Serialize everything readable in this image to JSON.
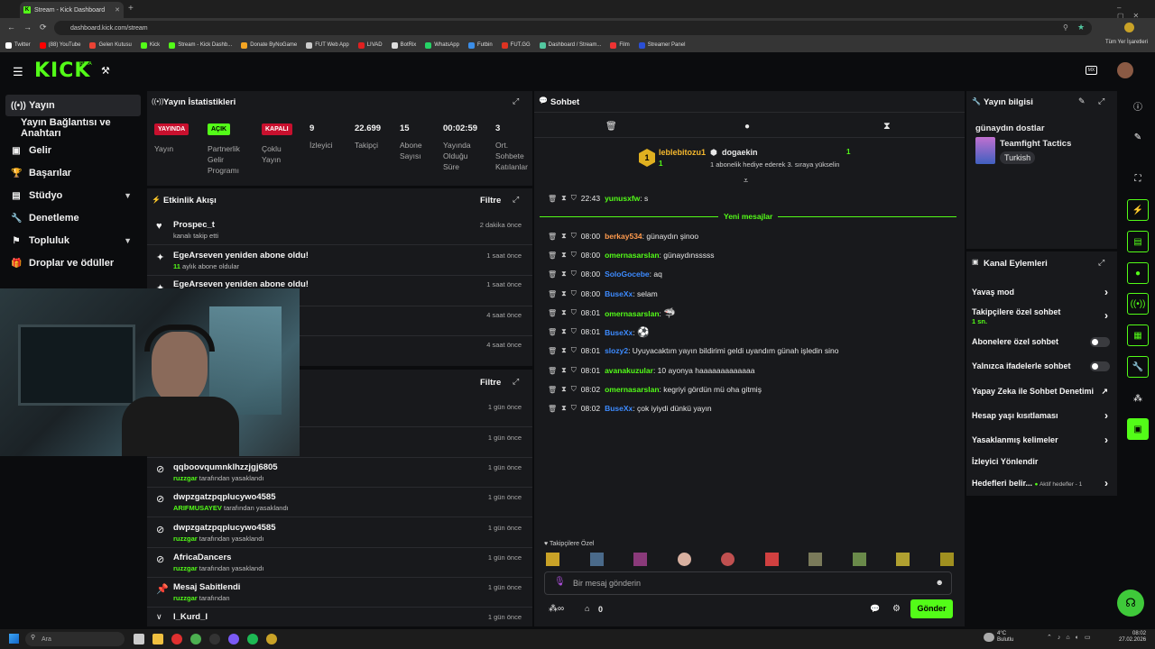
{
  "browser": {
    "tab_title": "Stream - Kick Dashboard",
    "new_tab": "+",
    "url": "dashboard.kick.com/stream",
    "bookmarks": [
      "Twitter",
      "(88) YouTube",
      "Gelen Kutusu",
      "Kick",
      "Stream - Kick Dashb...",
      "Donate ByNoGame",
      "FUT Web App",
      "LIVAD",
      "BotRix",
      "WhatsApp",
      "Futbin",
      "FUT.GG",
      "Dashboard / Stream...",
      "Film",
      "Streamer Panel"
    ],
    "all_bookmarks": "Tüm Yer İşaretleri"
  },
  "header": {
    "logo": "KICK",
    "beta": "BETA"
  },
  "sidebar": {
    "items": [
      {
        "label": "Yayın",
        "icon": "broadcast-icon"
      },
      {
        "label": "Yayın Bağlantısı ve Anahtarı"
      },
      {
        "label": "Gelir",
        "icon": "money-icon"
      },
      {
        "label": "Başarılar",
        "icon": "trophy-icon"
      },
      {
        "label": "Stüdyo",
        "icon": "studio-icon"
      },
      {
        "label": "Denetleme",
        "icon": "wrench-icon"
      },
      {
        "label": "Topluluk",
        "icon": "community-icon"
      },
      {
        "label": "Droplar ve ödüller",
        "icon": "gift-icon"
      }
    ]
  },
  "stats": {
    "title": "Yayın İstatistikleri",
    "items": [
      {
        "badge": "YAYINDA",
        "label": "Yayın"
      },
      {
        "badge": "AÇIK",
        "label": "Partnerlik Gelir Programı"
      },
      {
        "badge": "KAPALI",
        "label": "Çoklu Yayın"
      },
      {
        "value": "9",
        "label": "İzleyici"
      },
      {
        "value": "22.699",
        "label": "Takipçi"
      },
      {
        "value": "15",
        "label": "Abone Sayısı"
      },
      {
        "value": "00:02:59",
        "label": "Yayında Olduğu Süre"
      },
      {
        "value": "3",
        "label": "Ort. Sohbete Katılanlar"
      }
    ]
  },
  "activity": {
    "title": "Etkinlik Akışı",
    "filter": "Filtre",
    "rows": [
      {
        "title": "Prospec_t",
        "sub": "kanalı takip etti",
        "time": "2 dakika önce",
        "icon": "heart-icon"
      },
      {
        "title": "EgeArseven yeniden abone oldu!",
        "sub_green": "11",
        "sub": "aylık abone oldular",
        "time": "1 saat önce",
        "icon": "star-icon"
      },
      {
        "title": "EgeArseven yeniden abone oldu!",
        "sub": "",
        "time": "1 saat önce",
        "icon": "star-icon"
      },
      {
        "time": "4 saat önce"
      },
      {
        "time": "4 saat önce"
      }
    ]
  },
  "modlog": {
    "filter": "Filtre",
    "rows": [
      {
        "time": "1 gün önce"
      },
      {
        "time": "1 gün önce"
      },
      {
        "title": "qqboovqumnklhzzjgj6805",
        "mod": "ruzzgar",
        "sub": "tarafından yasaklandı",
        "time": "1 gün önce",
        "icon": "ban-icon"
      },
      {
        "title": "dwpzgatzpqplucywo4585",
        "mod": "ARIFMUSAYEV",
        "sub": "tarafından yasaklandı",
        "time": "1 gün önce",
        "icon": "ban-icon"
      },
      {
        "title": "dwpzgatzpqplucywo4585",
        "mod": "ruzzgar",
        "sub": "tarafından yasaklandı",
        "time": "1 gün önce",
        "icon": "ban-icon"
      },
      {
        "title": "AfricaDancers",
        "mod": "ruzzgar",
        "sub": "tarafından yasaklandı",
        "time": "1 gün önce",
        "icon": "ban-icon"
      },
      {
        "title": "Mesaj Sabitlendi",
        "mod": "ruzzgar",
        "sub": "tarafından",
        "time": "1 gün önce",
        "icon": "pin-icon"
      },
      {
        "title": "I_Kurd_I",
        "time": "1 gün önce",
        "icon": "chevron-down-icon"
      }
    ]
  },
  "chat": {
    "title": "Sohbet",
    "gifter1": {
      "name": "leblebitozu1",
      "count": "1"
    },
    "gifter2": {
      "name": "dogaekin",
      "count": "1",
      "note": "1 abonelik hediye ederek 3. sıraya yükselin"
    },
    "pinned": {
      "time": "22:43",
      "user": "yunusxfw",
      "text": "s"
    },
    "new_messages": "Yeni mesajlar",
    "messages": [
      {
        "time": "08:00",
        "user": "berkay534",
        "color": "orange",
        "text": "günaydın şinoo"
      },
      {
        "time": "08:00",
        "user": "omernasarslan",
        "color": "green",
        "text": "günaydınsssss"
      },
      {
        "time": "08:00",
        "user": "SoloGocebe",
        "color": "blue",
        "text": "aq"
      },
      {
        "time": "08:00",
        "user": "BuseXx",
        "color": "blue",
        "text": "selam"
      },
      {
        "time": "08:01",
        "user": "omernasarslan",
        "color": "green",
        "text": "",
        "emote": "🦈"
      },
      {
        "time": "08:01",
        "user": "BuseXx",
        "color": "blue",
        "text": "",
        "emote": "⚽"
      },
      {
        "time": "08:01",
        "user": "slozy2",
        "color": "blue",
        "text": "Uyuyacaktım yayın bildirimi geldi uyandım günah işledin sino"
      },
      {
        "time": "08:01",
        "user": "avanakuzular",
        "color": "green",
        "text": "10 ayonya haaaaaaaaaaaaa"
      },
      {
        "time": "08:02",
        "user": "omernasarslan",
        "color": "green",
        "text": "kegriyi gördün mü oha gitmiş"
      },
      {
        "time": "08:02",
        "user": "BuseXx",
        "color": "blue",
        "text": "çok iyiydi dünkü yayın"
      }
    ],
    "emote_label": "Takipçilere Özel",
    "input_placeholder": "Bir mesaj gönderin",
    "points": "0",
    "send": "Gönder"
  },
  "stream_info": {
    "title": "Yayın bilgisi",
    "stream_title": "günaydın dostlar",
    "category": "Teamfight Tactics",
    "language": "Turkish"
  },
  "channel_actions": {
    "title": "Kanal Eylemleri",
    "slow_mode": "Yavaş mod",
    "followers_only": "Takipçilere özel sohbet",
    "followers_only_sub": "1 sn.",
    "subs_only": "Abonelere özel sohbet",
    "emotes_only": "Yalnızca ifadelerle sohbet",
    "ai_moderation": "Yapay Zeka ile Sohbet Denetimi",
    "age_restriction": "Hesap yaşı kısıtlaması",
    "banned_words": "Yasaklanmış kelimeler",
    "viewer_redirect": "İzleyici Yönlendir",
    "goals": "Hedefleri belir...",
    "goals_sub": "Aktif hedefler - 1"
  },
  "taskbar": {
    "search": "Ara",
    "weather_temp": "4°C",
    "weather_desc": "Bulutlu",
    "clock_time": "08:02",
    "clock_date": "27.02.2026"
  }
}
